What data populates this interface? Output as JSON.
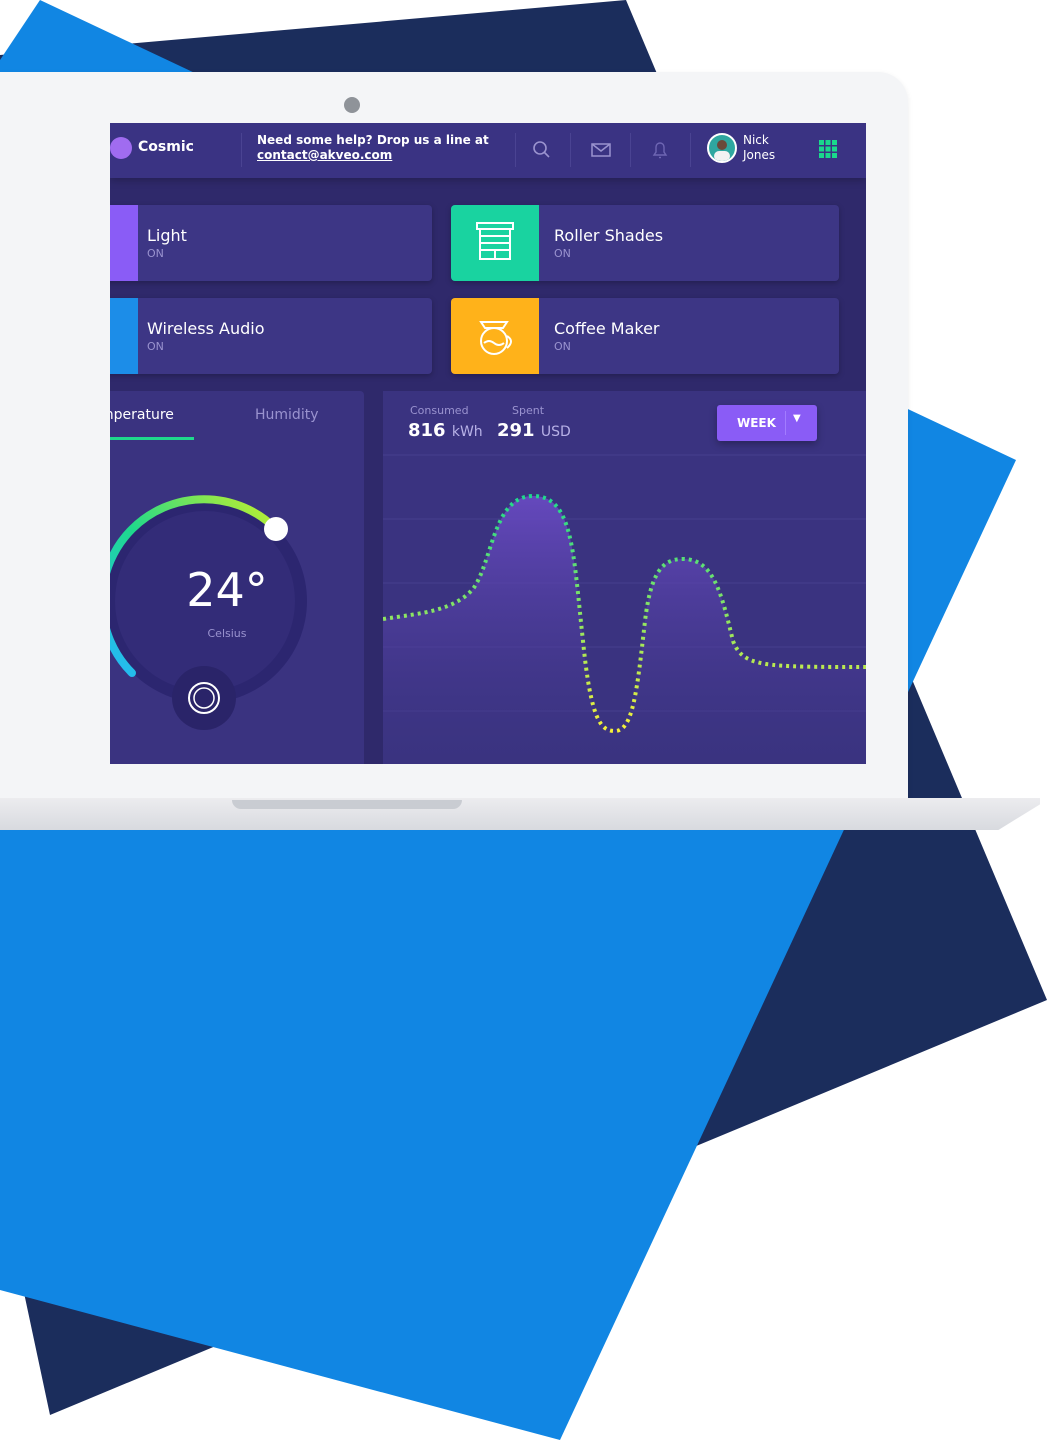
{
  "header": {
    "brand": "Cosmic",
    "help_line1": "Need some help? Drop us a line at",
    "help_email": "contact@akveo.com",
    "user_first": "Nick",
    "user_last": "Jones",
    "icons": [
      "search-icon",
      "mail-icon",
      "bell-icon",
      "apps-grid-icon"
    ]
  },
  "devices": [
    {
      "name": "Light",
      "state": "ON",
      "color": "#8a5cf6",
      "icon": "bulb-icon"
    },
    {
      "name": "Roller Shades",
      "state": "ON",
      "color": "#19d3a0",
      "icon": "roller-shades-icon"
    },
    {
      "name": "Wireless Audio",
      "state": "ON",
      "color": "#1c8de8",
      "icon": "audio-icon"
    },
    {
      "name": "Coffee Maker",
      "state": "ON",
      "color": "#ffb21a",
      "icon": "coffee-maker-icon"
    }
  ],
  "temperature": {
    "tabs": [
      "Temperature",
      "Humidity"
    ],
    "tab_visible_text": "mperature",
    "value": "24°",
    "unit": "Celsius"
  },
  "consumption": {
    "consumed_label": "Consumed",
    "consumed_value": "816",
    "consumed_unit": "kWh",
    "spent_label": "Spent",
    "spent_value": "291",
    "spent_unit": "USD",
    "period_button": "WEEK"
  },
  "colors": {
    "screen_bg": "#2f296b",
    "panel_bg": "#3a3380",
    "accent": "#8a5cf6",
    "green": "#1fd98c",
    "blue_shape": "#1186e3",
    "navy_shape": "#1b2d5c"
  }
}
